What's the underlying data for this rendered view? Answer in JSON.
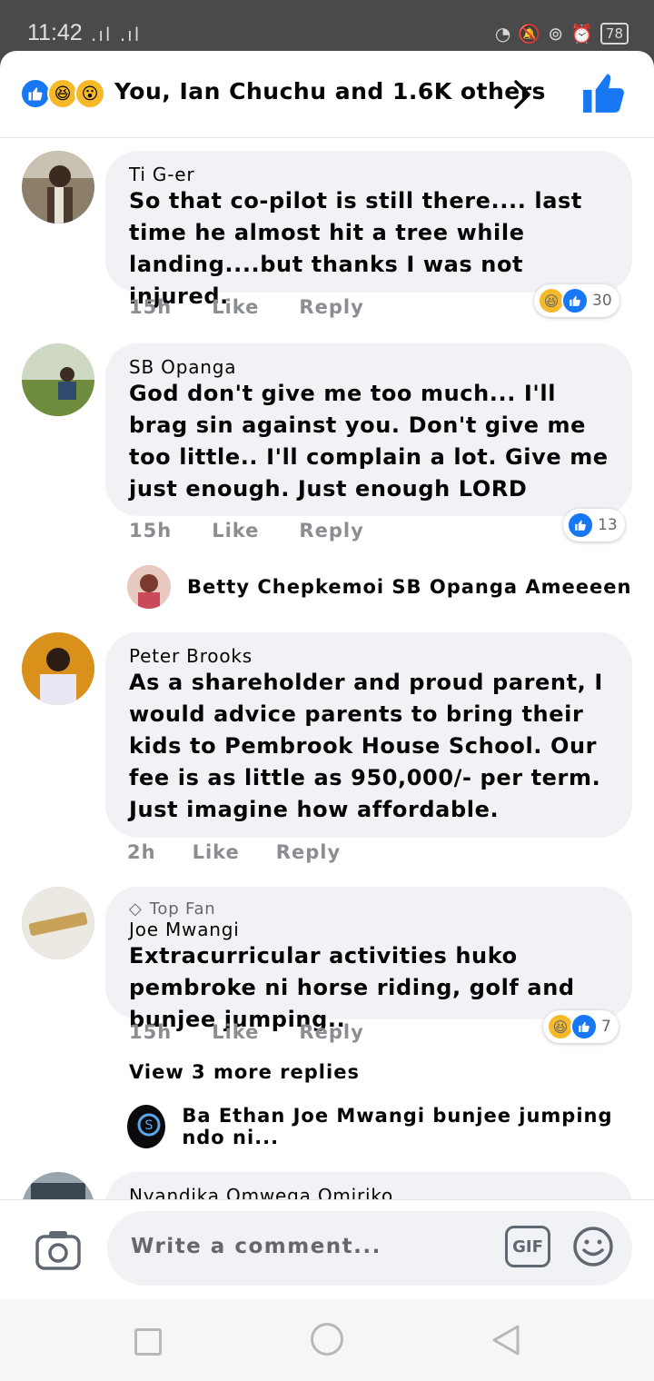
{
  "status_bar": {
    "time": "11:42",
    "signal": ".ıl .ıl",
    "battery": "78"
  },
  "reactions_header": {
    "summary": "You, Ian Chuchu and 1.6K others",
    "icons": [
      "like-icon",
      "haha-icon",
      "wow-icon"
    ]
  },
  "comments": [
    {
      "name": "Ti G-er",
      "text": "So that co-pilot is still there.... last time he almost hit a tree while landing....but thanks I was not injured.",
      "time": "15h",
      "like": "Like",
      "reply": "Reply",
      "reaction_count": "30",
      "reaction_icons": [
        "haha-icon",
        "like-icon"
      ]
    },
    {
      "name": "SB Opanga",
      "text": "God don't give me too much... I'll brag sin against you. Don't give me too little.. I'll complain a lot. Give me just enough. Just enough LORD",
      "time": "15h",
      "like": "Like",
      "reply": "Reply",
      "reaction_count": "13",
      "reaction_icons": [
        "like-icon"
      ],
      "reply_preview": "Betty Chepkemoi SB Opanga Ameeeen"
    },
    {
      "name": "Peter Brooks",
      "text": "As a shareholder and proud parent, I would advice parents to bring their kids to Pembrook House School. Our fee is as little as 950,000/- per term. Just imagine how affordable.",
      "time": "2h",
      "like": "Like",
      "reply": "Reply"
    },
    {
      "badge": "Top Fan",
      "name": "Joe Mwangi",
      "text": "Extracurricular activities huko pembroke ni horse riding, golf and bunjee jumping..",
      "time": "15h",
      "like": "Like",
      "reply": "Reply",
      "reaction_count": "7",
      "reaction_icons": [
        "haha-icon",
        "like-icon"
      ],
      "view_more": "View 3 more replies",
      "reply_preview": "Ba Ethan Joe Mwangi bunjee jumping ndo ni..."
    },
    {
      "name": "Nyandika Omwega Omiriko"
    }
  ],
  "composer": {
    "placeholder": "Write a comment...",
    "gif_label": "GIF"
  },
  "colors": {
    "like_blue": "#1877f2",
    "bubble": "#f0f2f5",
    "meta_gray": "#8a8d91"
  }
}
